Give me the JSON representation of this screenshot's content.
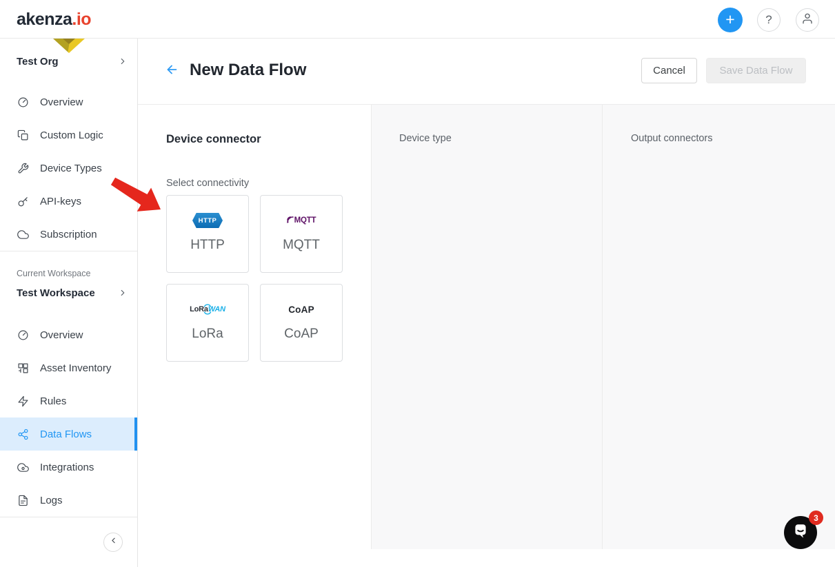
{
  "brand": {
    "name": "akenza",
    "tld": ".io"
  },
  "topbar": {
    "add_label": "+",
    "help_label": "?"
  },
  "sidebar": {
    "org_name": "Test Org",
    "org_nav": [
      {
        "label": "Overview"
      },
      {
        "label": "Custom Logic"
      },
      {
        "label": "Device Types"
      },
      {
        "label": "API-keys"
      },
      {
        "label": "Subscription"
      }
    ],
    "workspace_section_label": "Current Workspace",
    "workspace_name": "Test Workspace",
    "workspace_nav": [
      {
        "label": "Overview"
      },
      {
        "label": "Asset Inventory"
      },
      {
        "label": "Rules"
      },
      {
        "label": "Data Flows",
        "active": true
      },
      {
        "label": "Integrations"
      },
      {
        "label": "Logs"
      }
    ]
  },
  "header": {
    "title": "New Data Flow",
    "cancel_label": "Cancel",
    "save_label": "Save Data Flow"
  },
  "columns": {
    "device_connector_title": "Device connector",
    "device_type_title": "Device type",
    "output_connectors_title": "Output connectors",
    "select_connectivity_label": "Select connectivity"
  },
  "connectivity": [
    {
      "label": "HTTP",
      "logo_text": "HTTP"
    },
    {
      "label": "MQTT",
      "logo_text": "MQTT"
    },
    {
      "label": "LoRa",
      "logo_dark": "LoRa",
      "logo_cyan": "WAN"
    },
    {
      "label": "CoAP",
      "logo_text": "CoAP"
    }
  ],
  "chat": {
    "unread_count": "3"
  },
  "colors": {
    "accent": "#2196f3",
    "brand_red": "#e8432e",
    "active_item_bg": "#dcedfd",
    "annotation_arrow_red": "#e5271d",
    "badge_red": "#e02b20"
  }
}
